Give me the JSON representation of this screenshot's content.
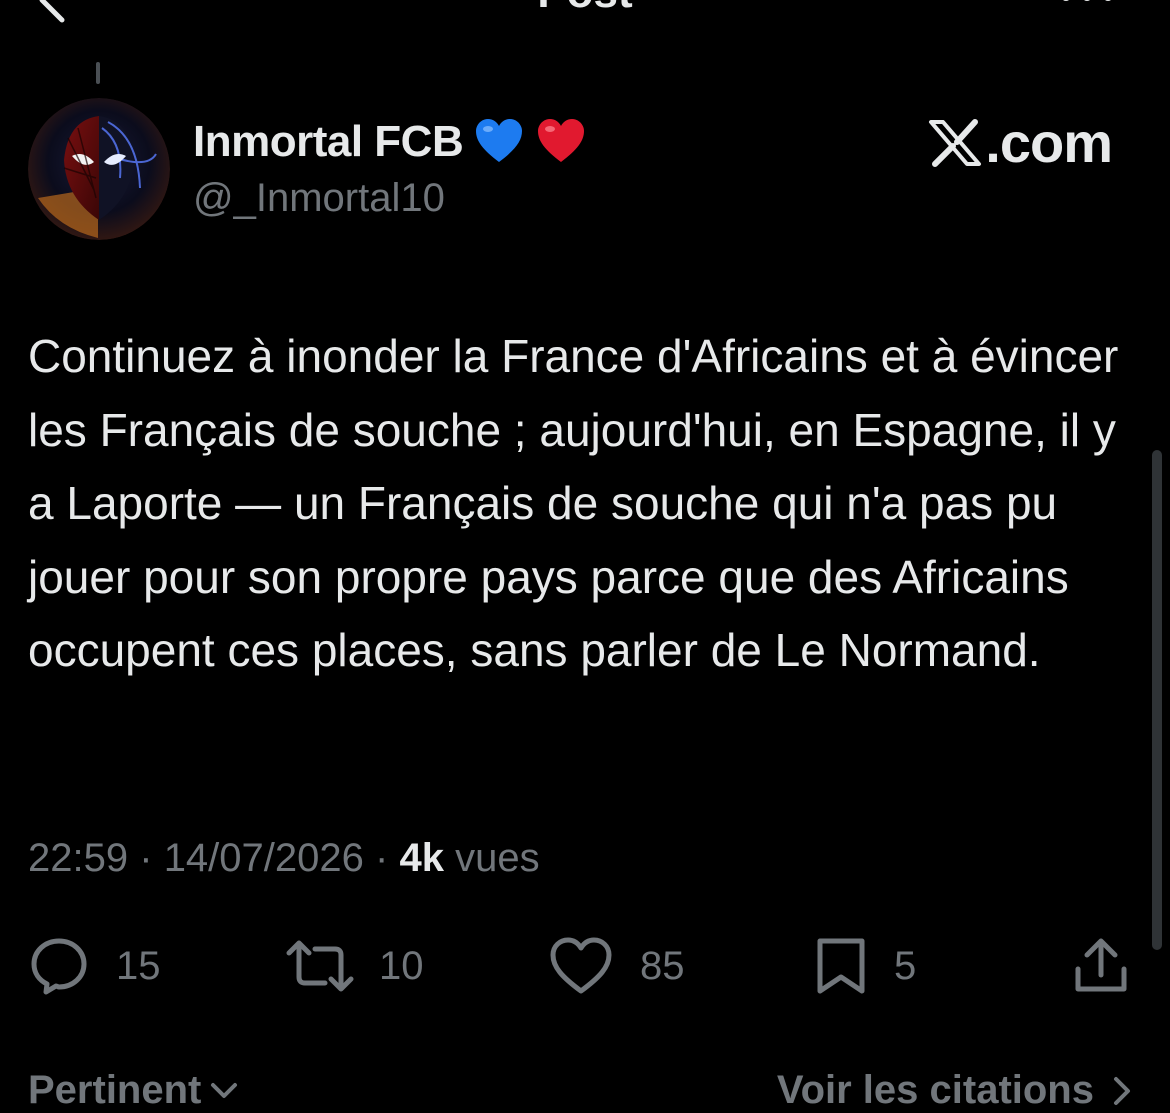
{
  "header": {
    "title": "Post",
    "back_icon": "chevron-left-icon",
    "more_icon": "more-horizontal-icon"
  },
  "post": {
    "author": {
      "display_name": "Inmortal FCB",
      "emojis": [
        "blue-heart",
        "red-heart"
      ],
      "handle": "@_Inmortal10"
    },
    "watermark": ".com",
    "text": "Continuez à inonder la France d'Africains et à évincer les Français de souche ; aujourd'hui, en Espagne, il y a Laporte — un Français de souche qui n'a pas pu jouer pour son propre pays parce que des Africains occupent ces places, sans parler de Le Normand.",
    "time": "22:59",
    "date": "14/07/2026",
    "separator": "·",
    "views_count": "4k",
    "views_label": "vues",
    "actions": {
      "replies": "15",
      "reposts": "10",
      "likes": "85",
      "bookmarks": "5"
    }
  },
  "footer": {
    "sort_label": "Pertinent",
    "quotes_label": "Voir les citations"
  },
  "colors": {
    "background": "#000000",
    "primary_text": "#e7e9ea",
    "secondary_text": "#71767b",
    "blue_heart": "#1d7bf0",
    "red_heart": "#e1192f"
  }
}
